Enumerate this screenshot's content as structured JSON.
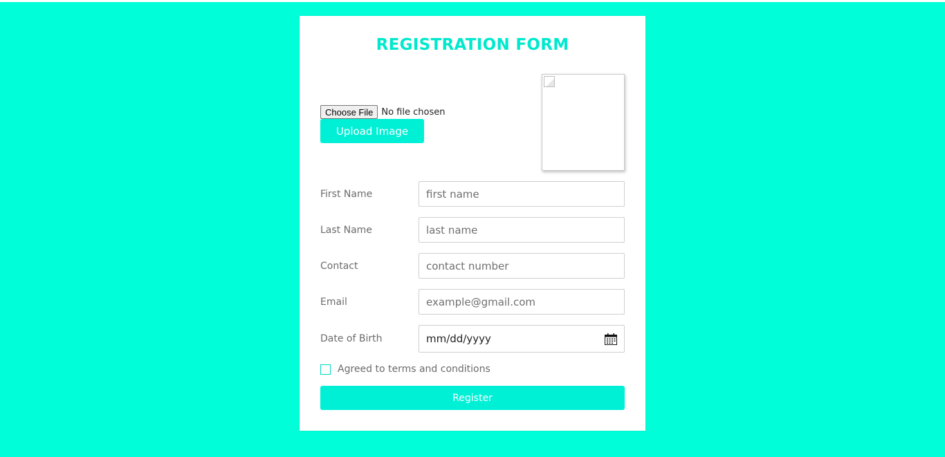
{
  "form": {
    "title": "REGISTRATION FORM",
    "file_button_label": "Choose File",
    "file_status": "No file chosen",
    "upload_label": "Upload Image",
    "fields": [
      {
        "label": "First Name",
        "placeholder": "first name"
      },
      {
        "label": "Last Name",
        "placeholder": "last name"
      },
      {
        "label": "Contact",
        "placeholder": "contact number"
      },
      {
        "label": "Email",
        "placeholder": "example@gmail.com"
      },
      {
        "label": "Date of Birth",
        "value": "mm/dd/yyyy",
        "icon": "calendar-icon"
      }
    ],
    "agree_label": "Agreed to terms and conditions",
    "agree_checked": false,
    "register_label": "Register"
  },
  "colors": {
    "background": "#00ffd9",
    "accent": "#00f0d6",
    "title": "#00e8cd",
    "card": "#ffffff"
  }
}
